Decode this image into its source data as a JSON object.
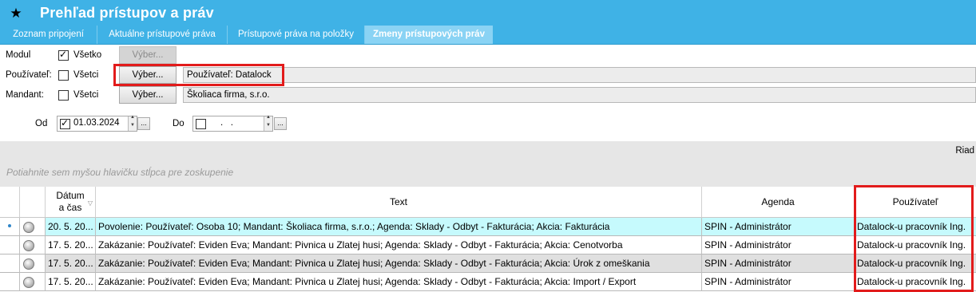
{
  "window": {
    "title": "Prehľad prístupov a práv"
  },
  "tabs": [
    {
      "label": "Zoznam pripojení",
      "active": false
    },
    {
      "label": "Aktuálne prístupové práva",
      "active": false
    },
    {
      "label": "Prístupové práva na položky",
      "active": false
    },
    {
      "label": "Zmeny prístupových práv",
      "active": true
    }
  ],
  "filters": {
    "modul": {
      "label": "Modul",
      "check_label": "Všetko",
      "checked": true,
      "button": "Výber..."
    },
    "pouzivatel": {
      "label": "Používateľ:",
      "check_label": "Všetci",
      "checked": false,
      "button": "Výber...",
      "value": "Používateľ: Datalock"
    },
    "mandant": {
      "label": "Mandant:",
      "check_label": "Všetci",
      "checked": false,
      "button": "Výber...",
      "value": "Školiaca firma, s.r.o."
    },
    "od": {
      "label": "Od",
      "checked": true,
      "value": "01.03.2024",
      "dots": "..."
    },
    "do": {
      "label": "Do",
      "checked": false,
      "value": ".   .",
      "dots": "..."
    }
  },
  "riadkov_label": "Riad",
  "group_hint": "Potiahnite sem myšou hlavičku stĺpca pre zoskupenie",
  "columns": {
    "datum": "Dátum\na čas",
    "text": "Text",
    "agenda": "Agenda",
    "pouzivatel": "Používateľ"
  },
  "rows": [
    {
      "datum": "20. 5. 20...",
      "text": "Povolenie: Používateľ: Osoba 10; Mandant: Školiaca firma, s.r.o.; Agenda: Sklady - Odbyt - Fakturácia; Akcia: Fakturácia",
      "agenda": "SPIN - Administrátor",
      "pouzivatel": "Datalock-u pracovník Ing."
    },
    {
      "datum": "17. 5. 20...",
      "text": "Zakázanie: Používateľ: Eviden Eva; Mandant: Pivnica u Zlatej husi; Agenda: Sklady - Odbyt - Fakturácia; Akcia: Cenotvorba",
      "agenda": "SPIN - Administrátor",
      "pouzivatel": "Datalock-u pracovník Ing."
    },
    {
      "datum": "17. 5. 20...",
      "text": "Zakázanie: Používateľ: Eviden Eva; Mandant: Pivnica u Zlatej husi; Agenda: Sklady - Odbyt - Fakturácia; Akcia: Úrok z omeškania",
      "agenda": "SPIN - Administrátor",
      "pouzivatel": "Datalock-u pracovník Ing."
    },
    {
      "datum": "17. 5. 20...",
      "text": "Zakázanie: Používateľ: Eviden Eva; Mandant: Pivnica u Zlatej husi; Agenda: Sklady - Odbyt - Fakturácia; Akcia: Import / Export",
      "agenda": "SPIN - Administrátor",
      "pouzivatel": "Datalock-u pracovník Ing."
    }
  ],
  "icons": {
    "title": "star-icon",
    "row": "user-icon",
    "sort": "sort-descending-icon"
  },
  "colors": {
    "accent": "#3fb2e6",
    "active_tab": "#8ad3f4",
    "selected_row": "#c6fafd",
    "highlight": "#e21b1b"
  }
}
